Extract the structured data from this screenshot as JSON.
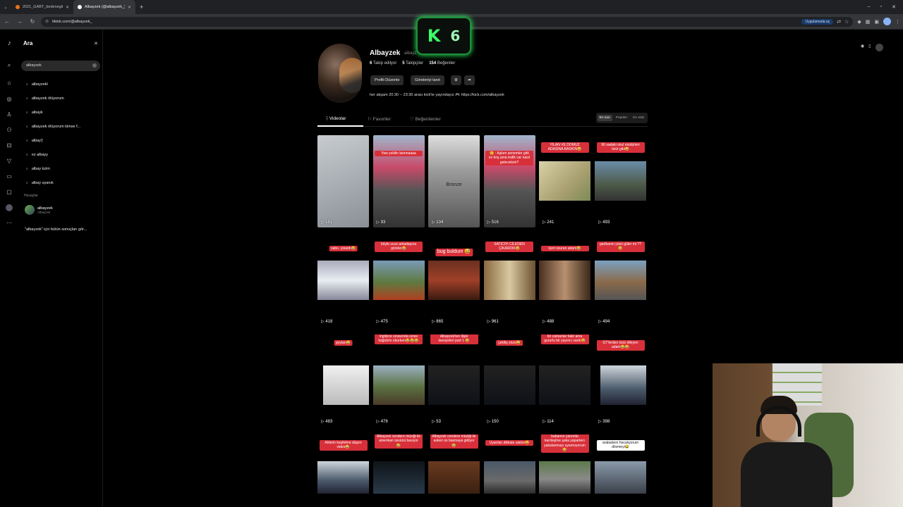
{
  "browser": {
    "tabs": [
      {
        "label": "2021_GABT_bedenegitim.pdf",
        "active": false
      },
      {
        "label": "Albayzek (@albayzek_) | TikTok",
        "active": true
      }
    ],
    "url": "tiktok.com/@albayzek_",
    "app_badge": "Uygulamada aç"
  },
  "search": {
    "title": "Ara",
    "query": "albayzek",
    "suggestions": [
      "albayzekl",
      "albayzek ölüyorum",
      "albayk",
      "albayzek ölüyorum kimse f...",
      "albay'j'",
      "ez albayy",
      "albay kzim",
      "albay uyanık"
    ],
    "accounts_header": "Hesaplar",
    "account": {
      "name": "albayzek",
      "nickname": "Albayzek"
    },
    "see_all": "\"albayzek\" için bütün sonuçları gör..."
  },
  "profile": {
    "name": "Albayzek",
    "handle": "albayz",
    "following_count": "6",
    "following_label": "Takip edilyor",
    "followers_count": "5",
    "followers_label": "Takipçiler",
    "likes_count": "154",
    "likes_label": "Beğeniler",
    "edit_button": "Profili Düzenle",
    "promote_button": "Gönderiyi tanıt",
    "bio": "her akşam 20:30 -- 23:30 arası kick'te yayındayız 🎮 https://kick.com/albayzek"
  },
  "overlay_logo": {
    "letter": "K",
    "number": "6"
  },
  "tabs": {
    "videos": "Videolar",
    "favorites": "Favoriler",
    "liked": "Beğenilenler"
  },
  "sort": {
    "latest": "En son",
    "popular": "Popüler",
    "oldest": "En eski"
  },
  "videos": [
    {
      "views": "151",
      "caption": "",
      "style": "full",
      "theme": "light"
    },
    {
      "views": "93",
      "caption": "Yaw çekilin lannnaaaa",
      "style": "full",
      "theme": "city"
    },
    {
      "views": "134",
      "caption": "Bronze",
      "style": "full",
      "theme": "face"
    },
    {
      "views": "516",
      "caption": "😢 : Aşkım annemler gitti ev boş ama trafik var nasıl geleceksin?",
      "style": "full",
      "theme": "city"
    },
    {
      "views": "241",
      "caption": "YILAN VE DOMUZ ADASINA BASKIN😅",
      "style": "mid",
      "theme": "sand"
    },
    {
      "views": "493",
      "caption": "90 sadaki okul müdürleri özür gibi😅",
      "style": "mid",
      "theme": "street"
    },
    {
      "views": "418",
      "caption": "sabo. çıkardı😂",
      "style": "mid",
      "theme": "room"
    },
    {
      "views": "475",
      "caption": "böyle ucuz arkadaşına gönder😂",
      "style": "mid",
      "theme": "yard"
    },
    {
      "views": "865",
      "caption": "bug buldum 😅",
      "style": "mid",
      "theme": "bar"
    },
    {
      "views": "961",
      "caption": "SATICIYI CİLEDEN ÇIKARDIK😅",
      "style": "mid",
      "theme": "shop"
    },
    {
      "views": "488",
      "caption": "içeri osuran adam😂",
      "style": "mid",
      "theme": "shop2"
    },
    {
      "views": "494",
      "caption": "garibanın yüzü güler mi ??😅",
      "style": "mid",
      "theme": "yard2"
    },
    {
      "views": "483",
      "caption": "şeytan😂",
      "style": "mid",
      "theme": "screen"
    },
    {
      "views": "476",
      "caption": "ingilizce sınavında sınav kağıdımı okurken😂😂😂",
      "style": "mid",
      "theme": "gta"
    },
    {
      "views": "53",
      "caption": "Albayzek'ten İlişki tavsiyeleri part 1 😂",
      "style": "mid",
      "theme": "dark"
    },
    {
      "views": "150",
      "caption": "çekiliş sözü😅",
      "style": "mid",
      "theme": "dark"
    },
    {
      "views": "114",
      "caption": "bir zamanlar fakir ama gururlu bir yayıncı vardı😅",
      "style": "mid",
      "theme": "dark"
    },
    {
      "views": "398",
      "caption": "GT'lerden özür dileyen adam😂😂",
      "style": "mid",
      "theme": "cam"
    },
    {
      "views": "",
      "caption": "Ahlerin keşfetme düşen video😂",
      "style": "mid",
      "theme": "cam"
    },
    {
      "views": "",
      "caption": "Albayzek cendere müziği ile amerikan üssünü basıyor😂",
      "style": "mid",
      "theme": "night"
    },
    {
      "views": "",
      "caption": "Albayzek cendere müziği ile askeri üs basmaya gidiyor😂",
      "style": "mid",
      "theme": "heli"
    },
    {
      "views": "",
      "caption": "Uyarılan dikkate alalım😅",
      "style": "mid",
      "theme": "street2"
    },
    {
      "views": "",
      "caption": "babamın yanında kardeşime şaka yaparken yakalanmayı uyarmıyorum😂",
      "style": "mid",
      "theme": "race"
    },
    {
      "views": "",
      "caption": "arabaların hocalıyorum dövmeyi😂",
      "style": "mid",
      "theme": "white"
    }
  ],
  "colors": {
    "caption_bg": "#d8303a",
    "k6_green": "#3bff6a"
  }
}
